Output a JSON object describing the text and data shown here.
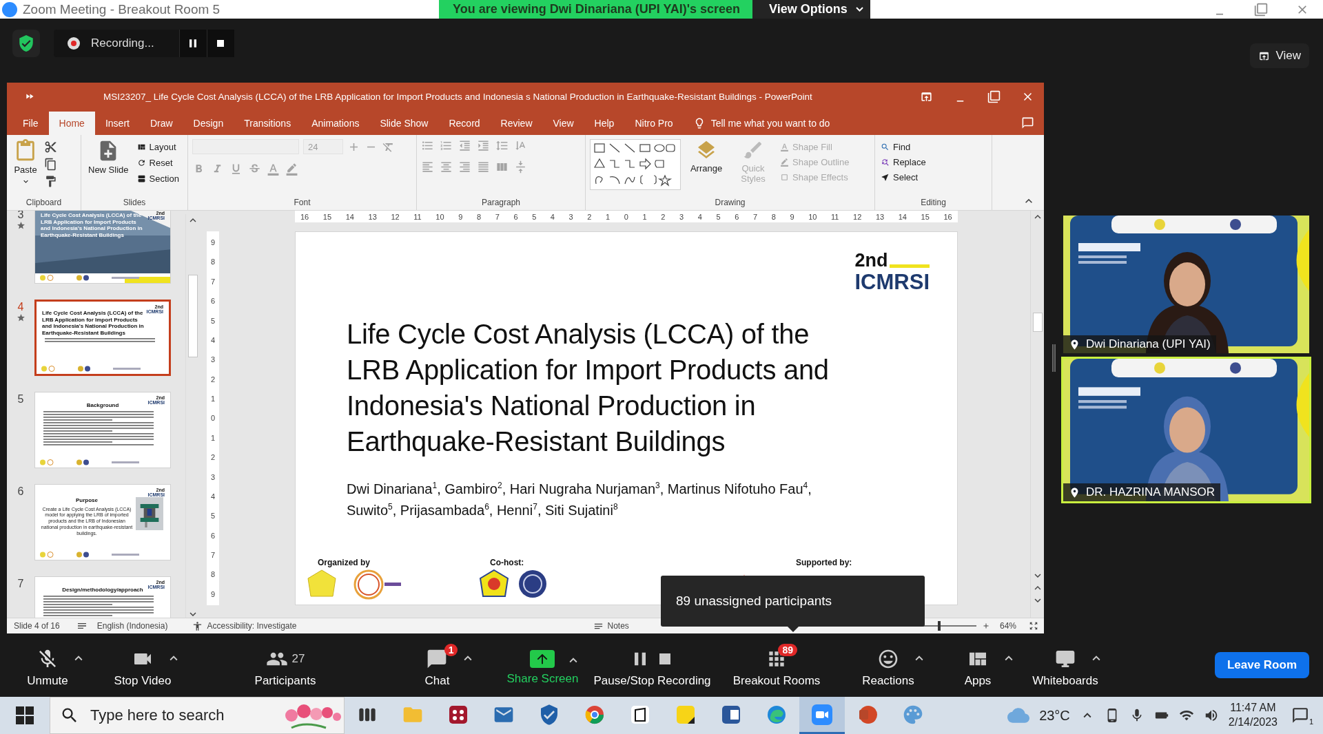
{
  "zoom_window": {
    "title": "Zoom Meeting - Breakout Room 5"
  },
  "share_banner": {
    "text": "You are viewing Dwi Dinariana (UPI YAI)'s screen",
    "button": "View Options"
  },
  "recording": {
    "label": "Recording..."
  },
  "view_button": {
    "label": "View"
  },
  "powerpoint": {
    "title": "MSI23207_ Life Cycle Cost Analysis (LCCA) of the LRB Application for Import Products and Indonesia s National Production in Earthquake-Resistant Buildings - PowerPoint",
    "tabs": [
      {
        "label": "File",
        "selected": false
      },
      {
        "label": "Home",
        "selected": true
      },
      {
        "label": "Insert",
        "selected": false
      },
      {
        "label": "Draw",
        "selected": false
      },
      {
        "label": "Design",
        "selected": false
      },
      {
        "label": "Transitions",
        "selected": false
      },
      {
        "label": "Animations",
        "selected": false
      },
      {
        "label": "Slide Show",
        "selected": false
      },
      {
        "label": "Record",
        "selected": false
      },
      {
        "label": "Review",
        "selected": false
      },
      {
        "label": "View",
        "selected": false
      },
      {
        "label": "Help",
        "selected": false
      },
      {
        "label": "Nitro Pro",
        "selected": false
      }
    ],
    "tell_me": "Tell me what you want to do",
    "ribbon": [
      {
        "kind": "clipboard",
        "label": "Clipboard",
        "paste": "Paste"
      },
      {
        "kind": "slides",
        "label": "Slides",
        "new_slide": "New Slide",
        "items": [
          "Layout",
          "Reset",
          "Section"
        ]
      },
      {
        "kind": "font",
        "label": "Font",
        "size": "24",
        "disabled": true
      },
      {
        "kind": "paragraph",
        "label": "Paragraph",
        "disabled": true
      },
      {
        "kind": "drawing",
        "label": "Drawing",
        "large": [
          {
            "label": "Arrange",
            "disabled": false
          },
          {
            "label": "Quick Styles",
            "disabled": true
          }
        ],
        "items": [
          {
            "label": "Shape Fill",
            "disabled": true
          },
          {
            "label": "Shape Outline",
            "disabled": true
          },
          {
            "label": "Shape Effects",
            "disabled": true
          }
        ]
      },
      {
        "kind": "editing",
        "label": "Editing",
        "items": [
          "Find",
          "Replace",
          "Select"
        ]
      }
    ],
    "thumbnails": [
      {
        "number": "3",
        "starred": true,
        "selected": false,
        "kind": "photo-title",
        "logo_top": "2nd",
        "logo_bottom": "ICMRSI",
        "title": "Life Cycle Cost Analysis (LCCA) of the LRB Application for Import Products and Indonesia's National Production in Earthquake-Resistant Buildings"
      },
      {
        "number": "4",
        "starred": true,
        "selected": true,
        "kind": "title",
        "logo_top": "2nd",
        "logo_bottom": "ICMRSI",
        "title": "Life Cycle Cost Analysis (LCCA) of the LRB Application for Import Products and Indonesia's National Production in Earthquake-Resistant Buildings"
      },
      {
        "number": "5",
        "starred": false,
        "selected": false,
        "kind": "content",
        "logo_top": "2nd",
        "logo_bottom": "ICMRSI",
        "title": "Background"
      },
      {
        "number": "6",
        "starred": false,
        "selected": false,
        "kind": "purpose",
        "logo_top": "2nd",
        "logo_bottom": "ICMRSI",
        "title": "Purpose",
        "body": "Create a Life Cycle Cost Analysis (LCCA) model for applying the LRB of imported products and the LRB of Indonesian national production in earthquake-resistant buildings."
      },
      {
        "number": "7",
        "starred": false,
        "selected": false,
        "kind": "content",
        "logo_top": "2nd",
        "logo_bottom": "ICMRSI",
        "title": "Design/methodology/approach"
      }
    ],
    "ruler_h": [
      "16",
      "15",
      "14",
      "13",
      "12",
      "11",
      "10",
      "9",
      "8",
      "7",
      "6",
      "5",
      "4",
      "3",
      "2",
      "1",
      "0",
      "1",
      "2",
      "3",
      "4",
      "5",
      "6",
      "7",
      "8",
      "9",
      "10",
      "11",
      "12",
      "13",
      "14",
      "15",
      "16"
    ],
    "ruler_v": [
      "9",
      "8",
      "7",
      "6",
      "5",
      "4",
      "3",
      "2",
      "1",
      "0",
      "1",
      "2",
      "3",
      "4",
      "5",
      "6",
      "7",
      "8",
      "9"
    ],
    "slide": {
      "logo_top": "2nd",
      "logo_bottom": "ICMRSI",
      "title_lines": [
        "Life Cycle Cost Analysis (LCCA) of the",
        "LRB Application for Import Products and",
        "Indonesia's National Production in",
        "Earthquake-Resistant Buildings"
      ],
      "author_lines": [
        "Dwi Dinariana$^{1}$, Gambiro$^{2}$, Hari Nugraha Nurjaman$^{3}$, Martinus Nifotuho Fau$^{4}$,",
        "Suwito$^{5}$, Prijasambada$^{6}$, Henni$^{7}$, Siti Sujatini$^{8}$"
      ],
      "footer": [
        {
          "label": "Organized by"
        },
        {
          "label": "Co-host:"
        },
        {
          "label": "Supported by:"
        }
      ]
    },
    "status_bar": {
      "slide": "Slide 4 of 16",
      "language": "English (Indonesia)",
      "accessibility": "Accessibility: Investigate",
      "notes": "Notes",
      "zoom": "64%",
      "zoom_slider": {
        "level": 0.3
      }
    }
  },
  "videos": [
    {
      "name": "Dwi Dinariana (UPI YAI)",
      "speaking": false
    },
    {
      "name": "DR. HAZRINA MANSOR",
      "speaking": true
    }
  ],
  "tooltip": "89 unassigned participants",
  "toolbar": [
    {
      "kind": "mic",
      "label": "Unmute",
      "caret": true
    },
    {
      "kind": "video",
      "label": "Stop Video",
      "caret": true
    },
    {
      "kind": "participants",
      "label": "Participants",
      "count": "27",
      "caret": false
    },
    {
      "kind": "chat",
      "label": "Chat",
      "badge": "1",
      "caret": true
    },
    {
      "kind": "share",
      "label": "Share Screen",
      "caret": true
    },
    {
      "kind": "record",
      "label": "Pause/Stop Recording",
      "caret": false
    },
    {
      "kind": "breakout",
      "label": "Breakout Rooms",
      "badge": "89",
      "caret": false
    },
    {
      "kind": "reactions",
      "label": "Reactions",
      "caret": true
    },
    {
      "kind": "apps",
      "label": "Apps",
      "caret": true
    },
    {
      "kind": "whiteboard",
      "label": "Whiteboards",
      "caret": true
    }
  ],
  "leave_button": "Leave Room",
  "taskbar": {
    "search_placeholder": "Type here to search",
    "apps": [
      {
        "kind": "task-view",
        "active": false
      },
      {
        "kind": "folder",
        "active": false
      },
      {
        "kind": "dots",
        "active": false
      },
      {
        "kind": "envelope",
        "active": false
      },
      {
        "kind": "shield",
        "active": false
      },
      {
        "kind": "round",
        "active": false
      },
      {
        "kind": "cube",
        "active": false
      },
      {
        "kind": "note",
        "active": false
      },
      {
        "kind": "document",
        "active": false
      },
      {
        "kind": "swirl",
        "active": false
      },
      {
        "kind": "camera",
        "active": true
      },
      {
        "kind": "slides",
        "active": false
      },
      {
        "kind": "palette",
        "active": false
      }
    ],
    "temperature": "23°C",
    "time": "11:47 AM",
    "date": "2/14/2023",
    "notifications": "1"
  }
}
